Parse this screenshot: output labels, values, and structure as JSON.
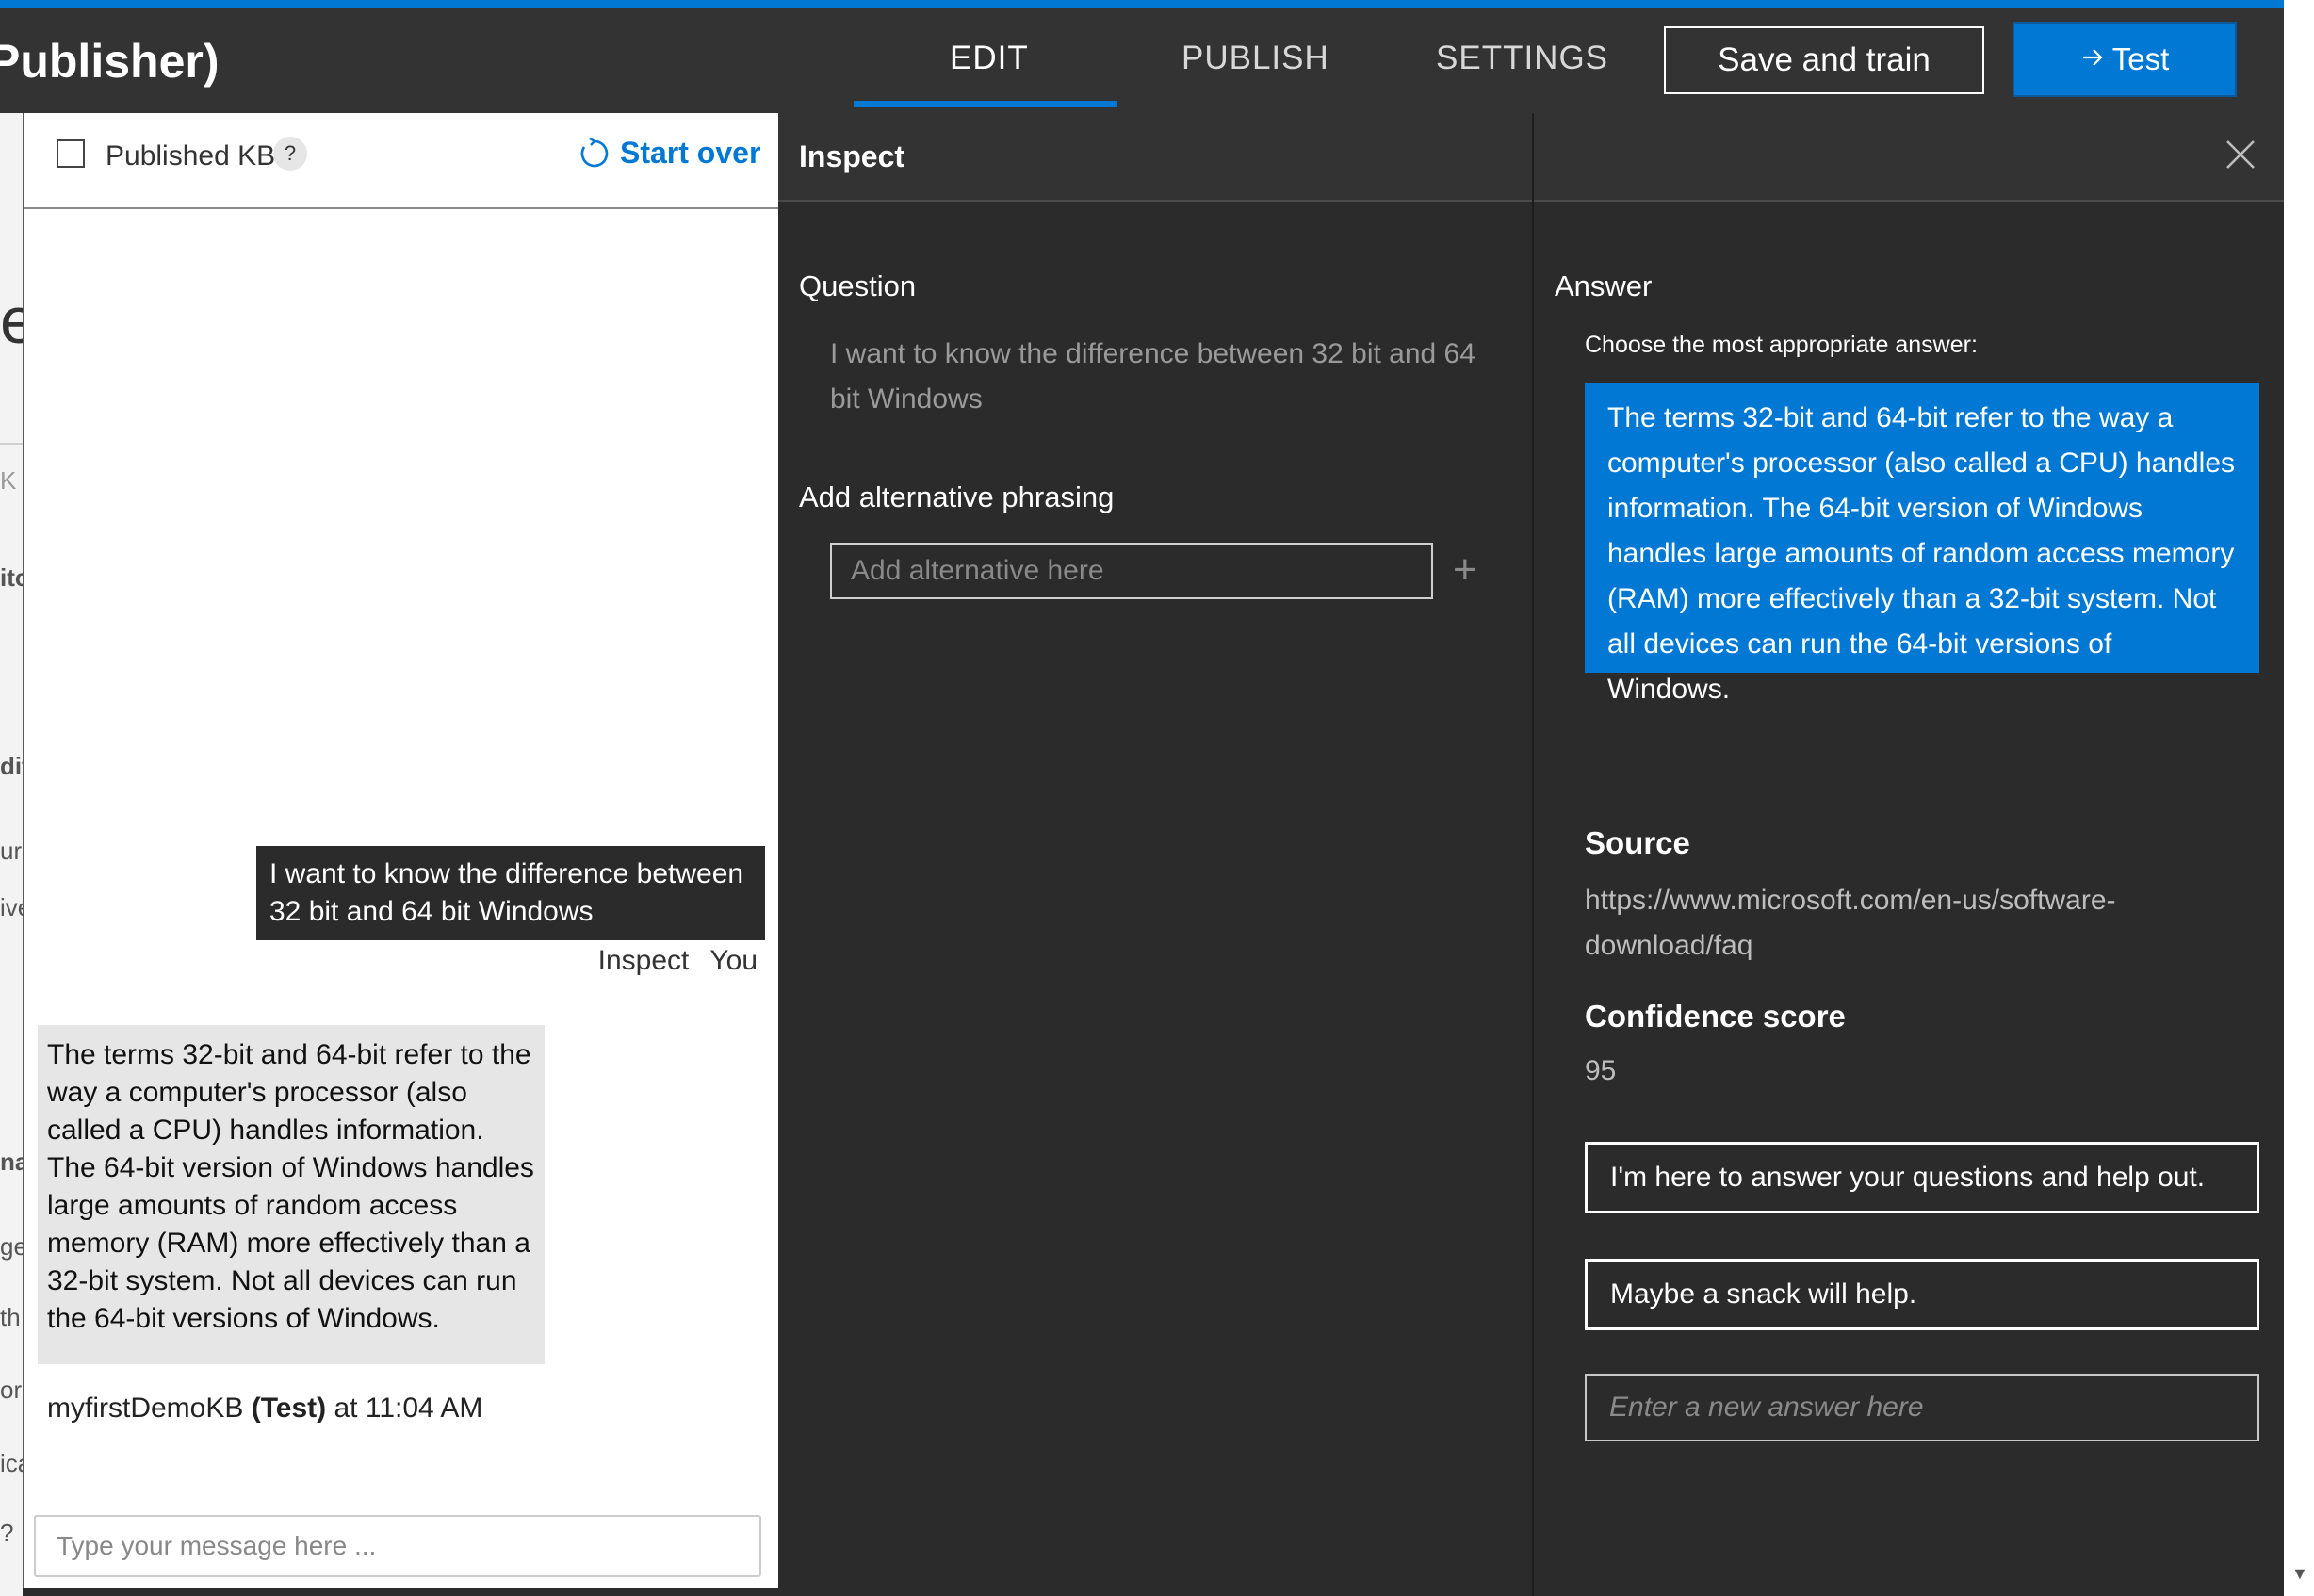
{
  "header": {
    "kb_title": "Publisher)",
    "tabs": [
      {
        "label": "EDIT",
        "active": true
      },
      {
        "label": "PUBLISH",
        "active": false
      },
      {
        "label": "SETTINGS",
        "active": false
      }
    ],
    "save_train_label": "Save and train",
    "test_label": "Test",
    "test_icon": "arrow-right-icon",
    "accent_color": "#0078d4"
  },
  "background_fragments": [
    "e",
    "K",
    "ito",
    "dit",
    "ur",
    "ive",
    "na",
    "ge",
    "th",
    "ore",
    "ica",
    "?"
  ],
  "chat": {
    "published_kb_label": "Published KB",
    "published_kb_checked": false,
    "help_label": "?",
    "start_over_label": "Start over",
    "user_message": "I want to know the difference between 32 bit and 64 bit Windows",
    "inspect_link": "Inspect",
    "user_name": "You",
    "bot_message": "The terms 32-bit and 64-bit refer to the way a computer's processor (also called a CPU) handles information. The 64-bit version of Windows handles large amounts of random access memory (RAM) more effectively than a 32-bit system. Not all devices can run the 64-bit versions of Windows.",
    "bot_name": "myfirstDemoKB",
    "bot_tag": "(Test)",
    "bot_time": "at 11:04 AM",
    "input_placeholder": "Type your message here ..."
  },
  "inspect": {
    "title": "Inspect",
    "question_label": "Question",
    "question_text": "I want to know the difference between 32 bit and 64 bit Windows",
    "alt_label": "Add alternative phrasing",
    "alt_placeholder": "Add alternative here",
    "plus": "+"
  },
  "answer": {
    "label": "Answer",
    "choose_label": "Choose the most appropriate answer:",
    "selected_answer": "The terms 32-bit and 64-bit refer to the way a computer's processor (also called a CPU) handles information. The 64-bit version of Windows handles large amounts of random access memory (RAM) more effectively than a 32-bit system. Not all devices can run the 64-bit versions of Windows.",
    "source_label": "Source",
    "source_url": "https://www.microsoft.com/en-us/software-download/faq",
    "confidence_label": "Confidence score",
    "confidence_score": "95",
    "options": [
      "I'm here to answer your questions and help out.",
      "Maybe a snack will help."
    ],
    "new_answer_placeholder": "Enter a new answer here"
  }
}
